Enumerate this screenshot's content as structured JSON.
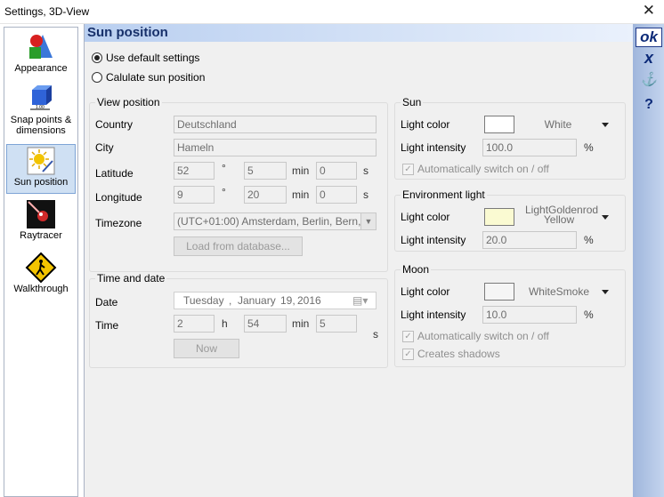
{
  "window": {
    "title": "Settings, 3D-View"
  },
  "sidebar": {
    "items": [
      {
        "label": "Appearance",
        "icon": "appearance-icon"
      },
      {
        "label": "Snap points & dimensions",
        "icon": "snap-points-icon"
      },
      {
        "label": "Sun position",
        "icon": "sun-position-icon",
        "selected": true
      },
      {
        "label": "Raytracer",
        "icon": "raytracer-icon"
      },
      {
        "label": "Walkthrough",
        "icon": "walkthrough-icon"
      }
    ]
  },
  "main": {
    "header": "Sun position",
    "radios": {
      "default": "Use default settings",
      "calculate": "Calulate sun position",
      "selected": "default"
    }
  },
  "view_position": {
    "title": "View position",
    "country_label": "Country",
    "country": "Deutschland",
    "city_label": "City",
    "city": "Hameln",
    "latitude_label": "Latitude",
    "lat_deg": "52",
    "lat_min": "5",
    "lat_sec": "0",
    "longitude_label": "Longitude",
    "lon_deg": "9",
    "lon_min": "20",
    "lon_sec": "0",
    "degree_unit": "°",
    "min_unit": "min",
    "sec_unit": "s",
    "timezone_label": "Timezone",
    "timezone": "(UTC+01:00) Amsterdam, Berlin, Bern,",
    "load_button": "Load from database..."
  },
  "time_date": {
    "title": "Time and date",
    "date_label": "Date",
    "weekday": "Tuesday",
    "sep": ",",
    "month": "January",
    "daynum": "19,",
    "year": "2016",
    "time_label": "Time",
    "hour": "2",
    "h_unit": "h",
    "minute": "54",
    "min_unit": "min",
    "second": "5",
    "s_unit": "s",
    "now_button": "Now"
  },
  "sun": {
    "title": "Sun",
    "color_label": "Light color",
    "color_name": "White",
    "color_hex": "#ffffff",
    "intensity_label": "Light intensity",
    "intensity": "100.0",
    "percent": "%",
    "auto_switch": "Automatically switch on / off"
  },
  "environment": {
    "title": "Environment light",
    "color_label": "Light color",
    "color_name_1": "LightGoldenrod",
    "color_name_2": "Yellow",
    "color_hex": "#fafad2",
    "intensity_label": "Light intensity",
    "intensity": "20.0",
    "percent": "%"
  },
  "moon": {
    "title": "Moon",
    "color_label": "Light color",
    "color_name": "WhiteSmoke",
    "color_hex": "#f5f5f5",
    "intensity_label": "Light intensity",
    "intensity": "10.0",
    "percent": "%",
    "auto_switch": "Automatically switch on / off",
    "shadows": "Creates shadows"
  },
  "rightbar": {
    "ok": "ok",
    "cancel": "x",
    "anchor_icon": "anchor-icon",
    "help": "?"
  }
}
